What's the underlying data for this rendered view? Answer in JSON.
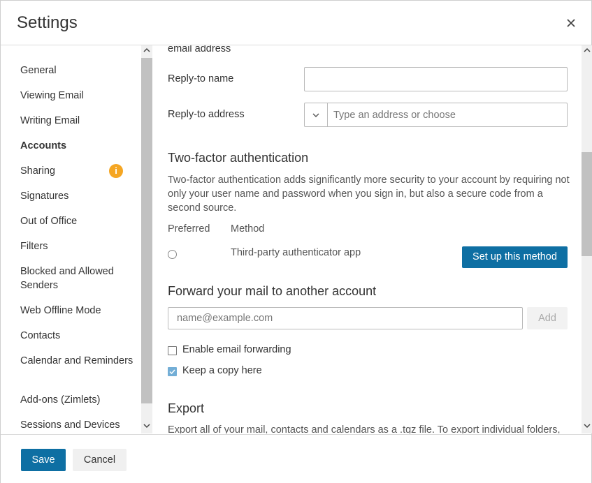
{
  "dialog": {
    "title": "Settings",
    "close_icon": "close-icon"
  },
  "sidebar": {
    "items": [
      {
        "label": "General"
      },
      {
        "label": "Viewing Email"
      },
      {
        "label": "Writing Email"
      },
      {
        "label": "Accounts",
        "active": true
      },
      {
        "label": "Sharing",
        "badge": "i"
      },
      {
        "label": "Signatures"
      },
      {
        "label": "Out of Office"
      },
      {
        "label": "Filters"
      },
      {
        "label": "Blocked and Allowed Senders"
      },
      {
        "label": "Web Offline Mode"
      },
      {
        "label": "Contacts"
      },
      {
        "label": "Calendar and Reminders"
      },
      {
        "label": "Add-ons (Zimlets)"
      },
      {
        "label": "Sessions and Devices"
      }
    ]
  },
  "main": {
    "partial_label": "email address",
    "reply_to_name": {
      "label": "Reply-to name",
      "value": ""
    },
    "reply_to_address": {
      "label": "Reply-to address",
      "placeholder": "Type an address or choose"
    },
    "two_factor": {
      "heading": "Two-factor authentication",
      "description": "Two-factor authentication adds significantly more security to your account by requiring not only your user name and password when you sign in, but also a secure code from a second source.",
      "col_preferred": "Preferred",
      "col_method": "Method",
      "method_name": "Third-party authenticator app",
      "setup_button": "Set up this method"
    },
    "forward": {
      "heading": "Forward your mail to another account",
      "placeholder": "name@example.com",
      "add_button": "Add",
      "enable_label": "Enable email forwarding",
      "enable_checked": false,
      "keep_copy_label": "Keep a copy here",
      "keep_copy_checked": true
    },
    "export": {
      "heading": "Export",
      "description": "Export all of your mail, contacts and calendars as a .tgz file. To export individual folders,"
    }
  },
  "footer": {
    "save": "Save",
    "cancel": "Cancel"
  },
  "colors": {
    "primary": "#0e6fa3",
    "warning": "#f5a623",
    "checkbox_checked": "#73aed6"
  }
}
